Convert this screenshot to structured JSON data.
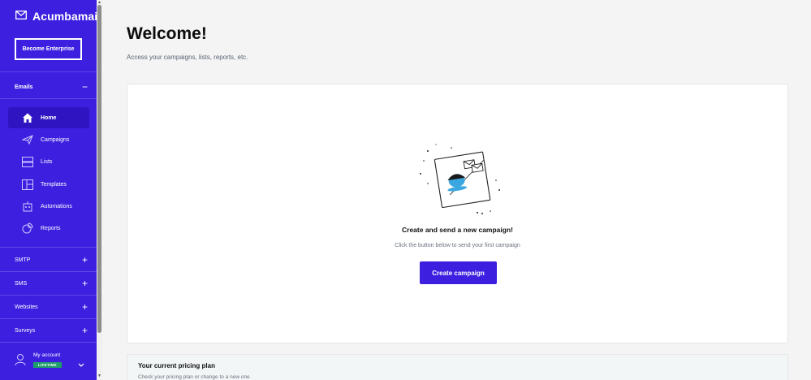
{
  "brand": {
    "name": "Acumbamail"
  },
  "sidebar": {
    "enterprise_button": "Become Enterprise",
    "emails_section": {
      "label": "Emails",
      "toggle": "−"
    },
    "items": [
      {
        "label": "Home",
        "icon": "home-icon",
        "active": true
      },
      {
        "label": "Campaigns",
        "icon": "paper-plane-icon"
      },
      {
        "label": "Lists",
        "icon": "list-icon"
      },
      {
        "label": "Templates",
        "icon": "template-icon"
      },
      {
        "label": "Automations",
        "icon": "robot-icon"
      },
      {
        "label": "Reports",
        "icon": "chart-icon"
      }
    ],
    "sections": [
      {
        "label": "SMTP",
        "toggle": "+"
      },
      {
        "label": "SMS",
        "toggle": "+"
      },
      {
        "label": "Websites",
        "toggle": "+"
      },
      {
        "label": "Surveys",
        "toggle": "+"
      }
    ],
    "account": {
      "label": "My account",
      "badge": "LIFETIME"
    }
  },
  "main": {
    "title": "Welcome!",
    "subtitle": "Access your campaigns, lists, reports, etc.",
    "empty_state": {
      "heading": "Create and send a new campaign!",
      "text": "Click the button below to send your first campaign",
      "button": "Create campaign"
    },
    "pricing": {
      "title": "Your current pricing plan",
      "subtitle": "Check your pricing plan or change to a new one"
    }
  },
  "colors": {
    "brand": "#3d1fe0",
    "brand_dark": "#2f15c2",
    "lifetime_badge": "#1e9e6a",
    "illustration_accent": "#3aa7e0"
  }
}
